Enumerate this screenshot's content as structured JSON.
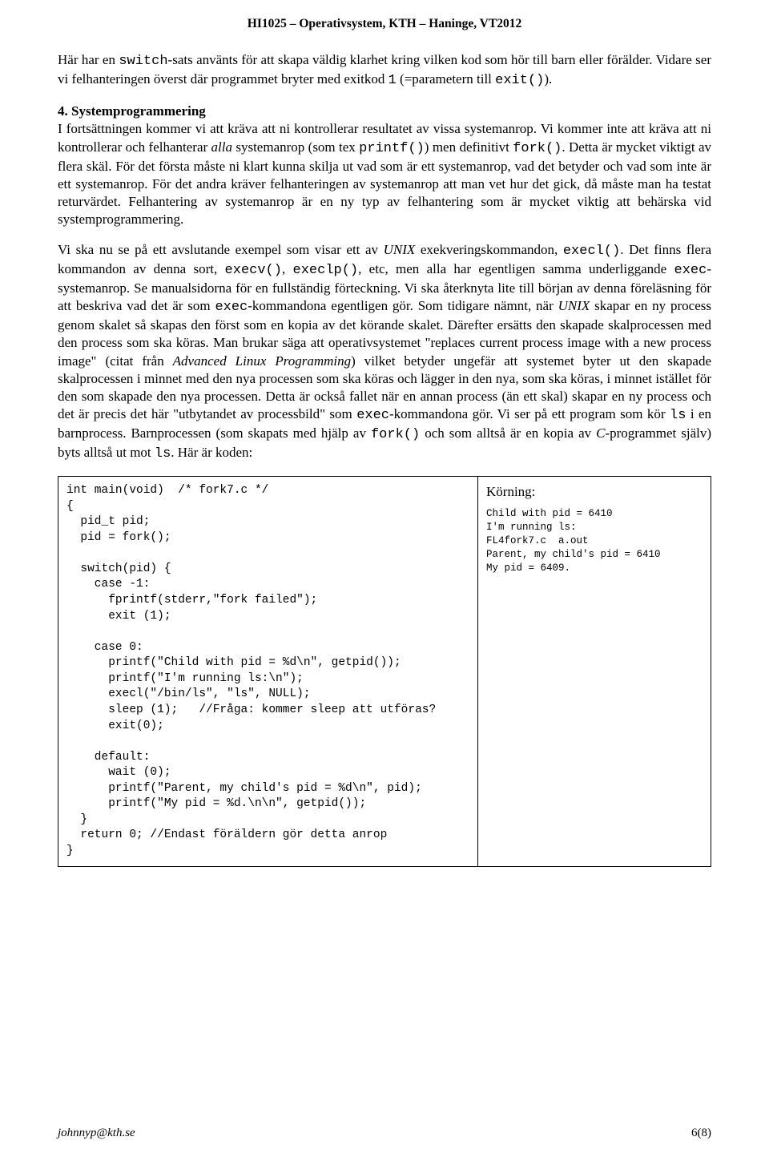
{
  "header": "HI1025 – Operativsystem, KTH – Haninge, VT2012",
  "p1": {
    "t1": "Här har en ",
    "c1": "switch",
    "t2": "-sats använts för att skapa väldig klarhet kring vilken kod som hör till barn eller förälder. Vidare ser vi felhanteringen överst där programmet bryter med exitkod ",
    "c2": "1",
    "t3": " (=parametern till ",
    "c3": "exit()",
    "t4": ")."
  },
  "section": {
    "num": "4. Systemprogrammering",
    "t1": "I fortsättningen kommer vi att kräva att ni kontrollerar resultatet av vissa systemanrop. Vi kommer inte att kräva att ni kontrollerar och felhanterar ",
    "i1": "alla",
    "t2": " systemanrop (som tex ",
    "c1": "printf()",
    "t3": ") men definitivt ",
    "c2": "fork()",
    "t4": ". Detta är mycket viktigt av flera skäl. För det första måste ni klart kunna skilja ut vad som är ett systemanrop, vad det betyder och vad som inte är ett systemanrop. För det andra kräver felhanteringen av systemanrop att man vet hur det gick, då måste man ha testat returvärdet. Felhantering av systemanrop är en ny typ av felhantering som är mycket viktig att behärska vid systemprogrammering."
  },
  "p3": {
    "t1": "Vi ska nu se på ett avslutande exempel som visar ett av ",
    "i1": "UNIX",
    "t2": " exekveringskommandon, ",
    "c1": "execl()",
    "t3": ". Det finns flera kommandon av denna sort, ",
    "c2": "execv()",
    "t4": ", ",
    "c3": "execlp()",
    "t5": ", etc, men alla har egentligen samma underliggande ",
    "c4": "exec",
    "t6": "-systemanrop. Se manualsidorna för en fullständig förteckning. Vi ska återknyta lite till början av denna föreläsning för att beskriva vad det är som ",
    "c5": "exec",
    "t7": "-kommandona egentligen gör. Som tidigare nämnt, när ",
    "i2": "UNIX",
    "t8": " skapar en ny process genom skalet så skapas den först som en kopia av det körande skalet. Därefter ersätts den skapade skalprocessen med den process som ska köras. Man brukar säga att operativsystemet \"replaces current process image with a new process image\" (citat från ",
    "i3": "Advanced Linux Programming",
    "t9": ") vilket betyder ungefär att systemet byter ut den skapade skalprocessen i minnet med den nya processen som ska köras och lägger in den nya, som ska köras, i minnet istället för den som skapade den nya processen. Detta är också fallet när en annan process (än ett skal) skapar en ny process och det är precis det här \"utbytandet av processbild\" som ",
    "c6": "exec",
    "t10": "-kommandona gör. Vi ser på ett program som kör ",
    "c7": "ls",
    "t11": " i en barnprocess. Barnprocessen (som skapats med hjälp av ",
    "c8": "fork()",
    "t12": " och som alltså är en kopia av ",
    "i4": "C",
    "t13": "-programmet själv) byts alltså ut mot ",
    "c9": "ls",
    "t14": ". Här är koden:"
  },
  "code": "int main(void)  /* fork7.c */\n{\n  pid_t pid;\n  pid = fork();\n\n  switch(pid) {\n    case -1:\n      fprintf(stderr,\"fork failed\");\n      exit (1);\n\n    case 0:\n      printf(\"Child with pid = %d\\n\", getpid());\n      printf(\"I'm running ls:\\n\");\n      execl(\"/bin/ls\", \"ls\", NULL);\n      sleep (1);   //Fråga: kommer sleep att utföras?\n      exit(0);\n\n    default:\n      wait (0);\n      printf(\"Parent, my child's pid = %d\\n\", pid);\n      printf(\"My pid = %d.\\n\\n\", getpid());\n  }\n  return 0; //Endast föräldern gör detta anrop\n}",
  "run": {
    "title": "Körning:",
    "out": "Child with pid = 6410\nI'm running ls:\nFL4fork7.c  a.out\nParent, my child's pid = 6410\nMy pid = 6409."
  },
  "footer": {
    "email": "johnnyp@kth.se",
    "page": "6(8)"
  }
}
